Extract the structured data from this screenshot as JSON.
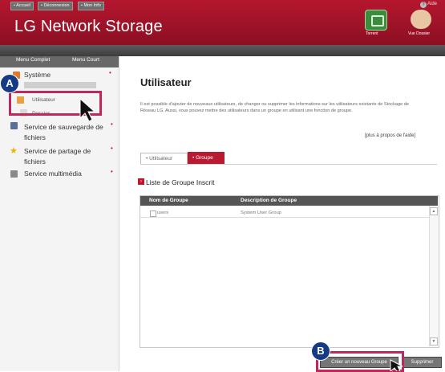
{
  "header": {
    "app_title": "LG Network Storage",
    "torrent_label": "Torrent",
    "folder_label": "Vue Dossier"
  },
  "toolbar": {
    "accueil": "• Accueil",
    "deconnexion": "• Déconnexion",
    "mon_info": "• Mon Info",
    "aide": "Aide"
  },
  "sidebar": {
    "menu_complet": "Menu Complet",
    "menu_court": "Menu Court",
    "systeme": "Système",
    "utilisateur": "Utilisateur",
    "dossier": "Dossier",
    "sauvegarde": "Service de sauvegarde de fichiers",
    "partage": "Service de partage de fichiers",
    "multimedia": "Service multimédia"
  },
  "main": {
    "title": "Utilisateur",
    "description": "Il est possible d'ajouter de nouveaux utilisateurs, de changer ou supprimer les informations sur les utilisateurs existants de Stockage de Réseau LG. Aussi, vous pouvez mettre des utilisateurs dans un groupe en utilisant une fonction de groupe.",
    "about_link": "[plus à propos de l'aide]",
    "tab_utilisateur": "• Utilisateur",
    "tab_groupe": "• Groupe",
    "section_title": "Liste de Groupe Inscrit",
    "table": {
      "columns": [
        "Nom de Groupe",
        "Description de Groupe"
      ],
      "rows": [
        {
          "name": "users",
          "description": "System User Group"
        }
      ]
    },
    "btn_create": "Créer un nouveau Groupe",
    "btn_delete": "Supprimer"
  },
  "annotations": {
    "badge_a": "A",
    "badge_b": "B"
  },
  "colors": {
    "brand_red": "#b5172f",
    "annotation_box": "#c0285c",
    "badge_blue": "#153a86"
  }
}
